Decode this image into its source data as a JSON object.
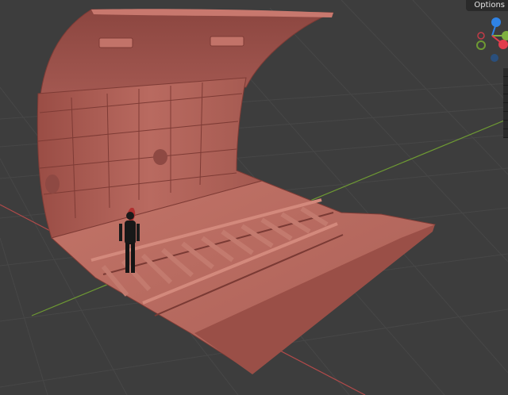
{
  "header": {
    "options_label": "Options"
  },
  "gizmo": {
    "axes": [
      {
        "axis": "Z",
        "color": "#2f83e6"
      },
      {
        "axis": "Y",
        "color": "#7fb040"
      },
      {
        "axis": "X",
        "color": "#e23d4d"
      }
    ]
  },
  "colors": {
    "background": "#3d3d3d",
    "grid": "#4a4a4a",
    "x_axis": "#b34a4a",
    "y_axis": "#6e9a33",
    "model": "#b8625a"
  },
  "icons": [
    "tool-strip-icon"
  ]
}
